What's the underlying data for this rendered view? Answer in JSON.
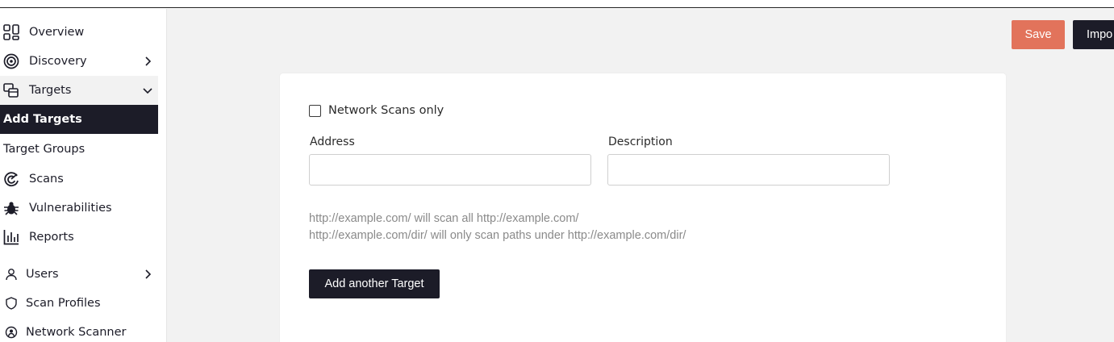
{
  "sidebar": {
    "items": [
      {
        "label": "Overview",
        "icon": "grid-icon"
      },
      {
        "label": "Discovery",
        "icon": "target-icon"
      },
      {
        "label": "Targets",
        "icon": "targets-icon"
      },
      {
        "label": "Add Targets"
      },
      {
        "label": "Target Groups"
      },
      {
        "label": "Scans",
        "icon": "scans-icon"
      },
      {
        "label": "Vulnerabilities",
        "icon": "bug-icon"
      },
      {
        "label": "Reports",
        "icon": "reports-icon"
      },
      {
        "label": "Users",
        "icon": "user-icon"
      },
      {
        "label": "Scan Profiles",
        "icon": "shield-icon"
      },
      {
        "label": "Network Scanner",
        "icon": "network-scanner-icon"
      }
    ]
  },
  "toolbar": {
    "save_label": "Save",
    "import_label": "Impo"
  },
  "form": {
    "network_scans_label": "Network Scans only",
    "address_label": "Address",
    "description_label": "Description",
    "address_value": "",
    "description_value": "",
    "hint_line_1": "http://example.com/ will scan all http://example.com/",
    "hint_line_2": "http://example.com/dir/ will only scan paths under http://example.com/dir/",
    "add_button_label": "Add another Target"
  },
  "colors": {
    "accent": "#e2735b",
    "dark": "#1c1c28",
    "background": "#f2f2f2"
  }
}
